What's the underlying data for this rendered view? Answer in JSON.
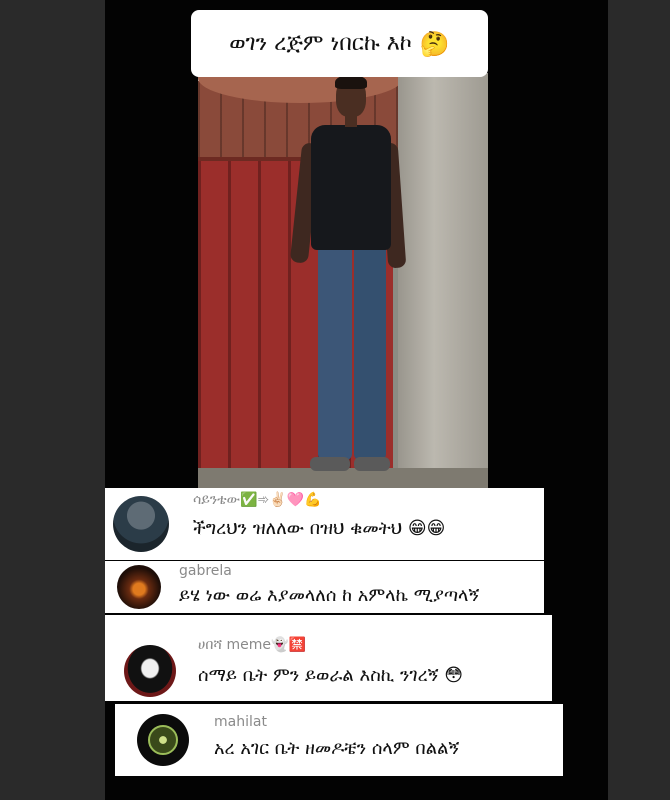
{
  "caption": {
    "text": "ወገን ረጅም ነበርኩ እኮ",
    "emoji": "🤔"
  },
  "comments": [
    {
      "username": "ሳይንቴው",
      "badges": "✅➾✌🏻🩷💪",
      "text": "ችግረህን ዝለለው በዝህ ቁመትህ",
      "emoji": "😁😁"
    },
    {
      "username": "gabrela",
      "badges": "",
      "text": "ይሄ ነው ወሬ እያመላለሰ ከ አምላኬ ሚያጣላኝ",
      "emoji": ""
    },
    {
      "username": "ሀበሻ meme",
      "badges": "👻🈲",
      "text": "ሰማይ ቤት ምን ይወራል እስኪ ንገረኝ",
      "emoji": "😳"
    },
    {
      "username": "mahilat",
      "badges": "",
      "text": "አረ አገር ቤት ዘመዶቼን ሰላም በልልኝ",
      "emoji": ""
    }
  ],
  "colors": {
    "background": "#030303",
    "card": "#ffffff",
    "username": "#8a8a8a",
    "gate": "#9b2e2b"
  },
  "icons": {
    "avatar_1": "profile-photo",
    "avatar_2": "profile-photo",
    "avatar_3": "ghostface-mask",
    "avatar_4": "emblem-logo"
  }
}
